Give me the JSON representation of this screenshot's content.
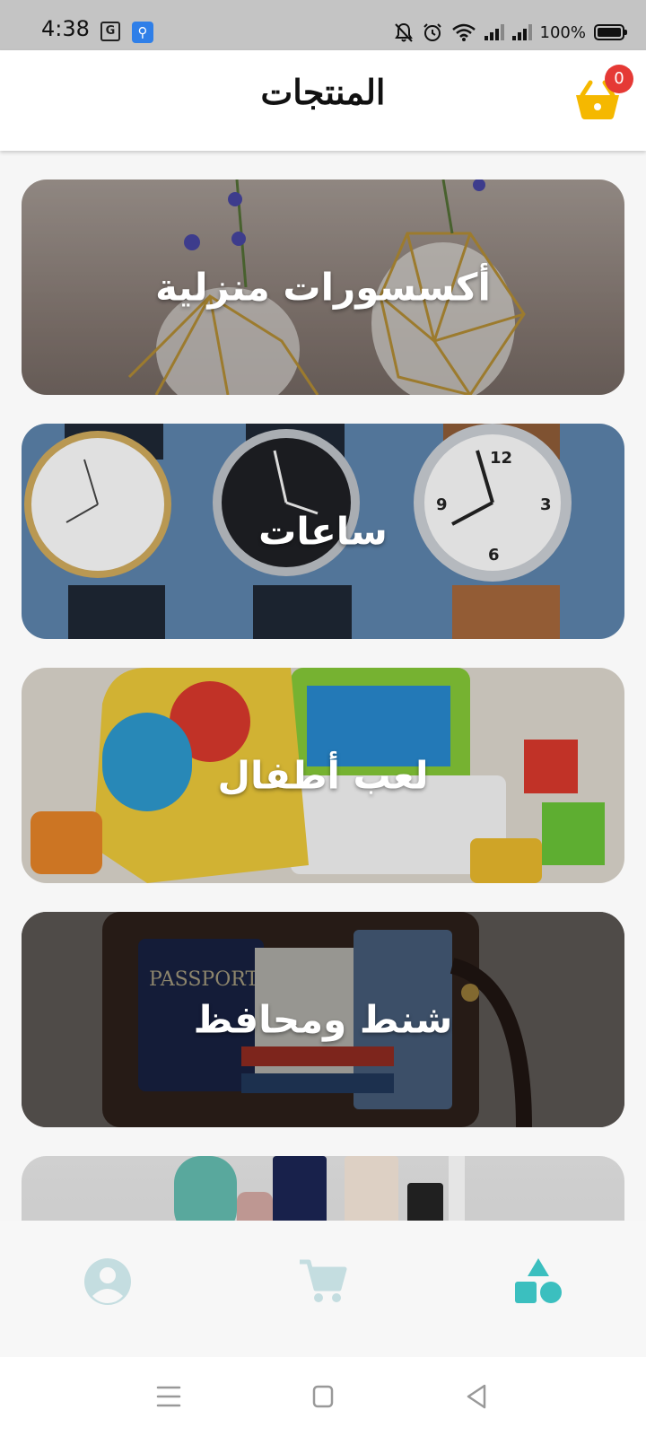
{
  "status_bar": {
    "time": "4:38",
    "translate_icon_text": "G",
    "battery_percent": "100%",
    "battery_level": 1.0,
    "icons": [
      "translate-icon",
      "usb-icon",
      "mute-icon",
      "alarm-icon",
      "wifi-icon",
      "signal-icon",
      "signal-icon",
      "battery-icon"
    ]
  },
  "header": {
    "title": "المنتجات",
    "cart_count": "0"
  },
  "categories": [
    {
      "label": "أكسسورات منزلية",
      "image": "vases-with-flowers"
    },
    {
      "label": "ساعات",
      "image": "wristwatches"
    },
    {
      "label": "لعب أطفال",
      "image": "toys"
    },
    {
      "label": "شنط ومحافظ",
      "image": "leather-bag"
    },
    {
      "label": "",
      "image": "perfume-bottles"
    }
  ],
  "bottom_nav": {
    "items": [
      {
        "icon": "profile-icon",
        "active": false
      },
      {
        "icon": "cart-icon",
        "active": false
      },
      {
        "icon": "categories-icon",
        "active": true
      }
    ],
    "active_color": "#3bbfbf",
    "inactive_color": "#c4dde0"
  },
  "system_nav": {
    "icons": [
      "menu-icon",
      "home-icon",
      "back-icon"
    ]
  },
  "colors": {
    "accent": "#3bbfbf",
    "cart_header": "#f5b800",
    "badge": "#e53935",
    "status_bar": "#c4c4c4"
  }
}
